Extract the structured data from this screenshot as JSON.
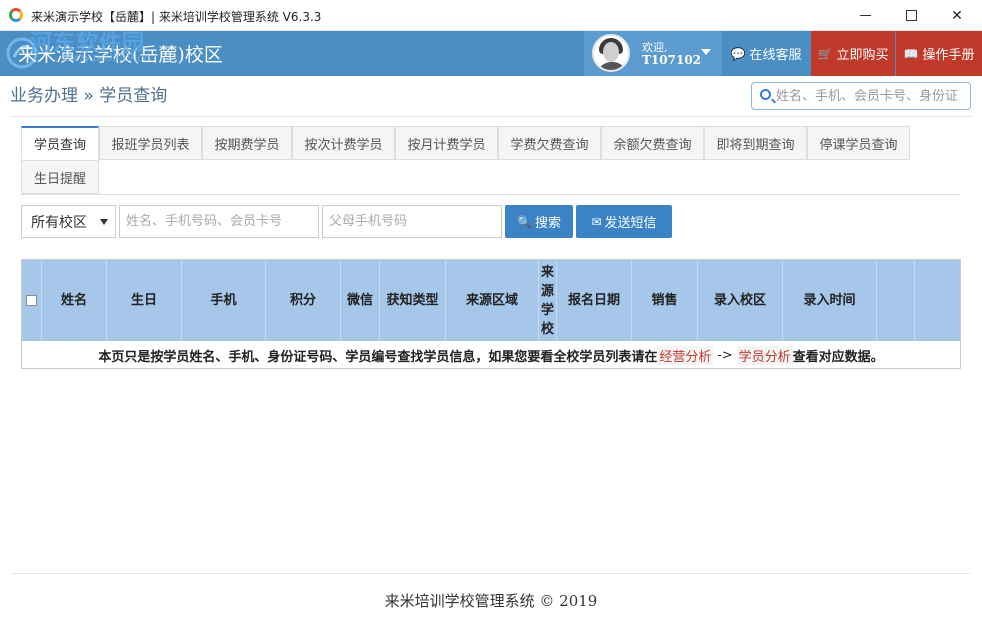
{
  "window": {
    "title": "来米演示学校【岳麓】| 来米培训学校管理系统 V6.3.3",
    "controls": [
      "minimize",
      "maximize",
      "close"
    ]
  },
  "header": {
    "brand": "来米演示学校(岳麓)校区",
    "watermark": "河东软件园",
    "watermark_url": "www.pc0359.cn",
    "user": {
      "welcome": "欢迎,",
      "name": "T107102"
    },
    "buttons": [
      {
        "label": "在线客服",
        "icon": "chat-icon"
      },
      {
        "label": "立即购买",
        "icon": "cart-icon"
      },
      {
        "label": "操作手册",
        "icon": "book-icon"
      }
    ],
    "colors": {
      "header_bg": "#4a8ec4",
      "accent_red": "#c0392b"
    }
  },
  "breadcrumb": {
    "text": "业务办理 » 学员查询"
  },
  "top_search": {
    "placeholder": "姓名、手机、会员卡号、身份证"
  },
  "tabs": [
    {
      "label": "学员查询",
      "active": true
    },
    {
      "label": "报班学员列表"
    },
    {
      "label": "按期费学员"
    },
    {
      "label": "按次计费学员"
    },
    {
      "label": "按月计费学员"
    },
    {
      "label": "学费欠费查询"
    },
    {
      "label": "余额欠费查询"
    },
    {
      "label": "即将到期查询"
    },
    {
      "label": "停课学员查询"
    },
    {
      "label": "生日提醒"
    }
  ],
  "filters": {
    "campus_selected": "所有校区",
    "query_placeholder": "姓名、手机号码、会员卡号",
    "parent_phone_placeholder": "父母手机号码",
    "search_label": "搜索",
    "sms_label": "发送短信"
  },
  "table": {
    "columns": [
      "",
      "姓名",
      "生日",
      "手机",
      "积分",
      "微信",
      "获知类型",
      "来源区域",
      "来源学校",
      "报名日期",
      "销售",
      "录入校区",
      "录入时间",
      "",
      ""
    ],
    "note_prefix": "本页只是按学员姓名、手机、身份证号码、学员编号查找学员信息，如果您要看全校学员列表请在",
    "note_link1": "经营分析",
    "note_arrow": "->",
    "note_link2": "学员分析",
    "note_suffix": "查看对应数据。"
  },
  "footer": {
    "text": "来米培训学校管理系统 © 2019"
  }
}
